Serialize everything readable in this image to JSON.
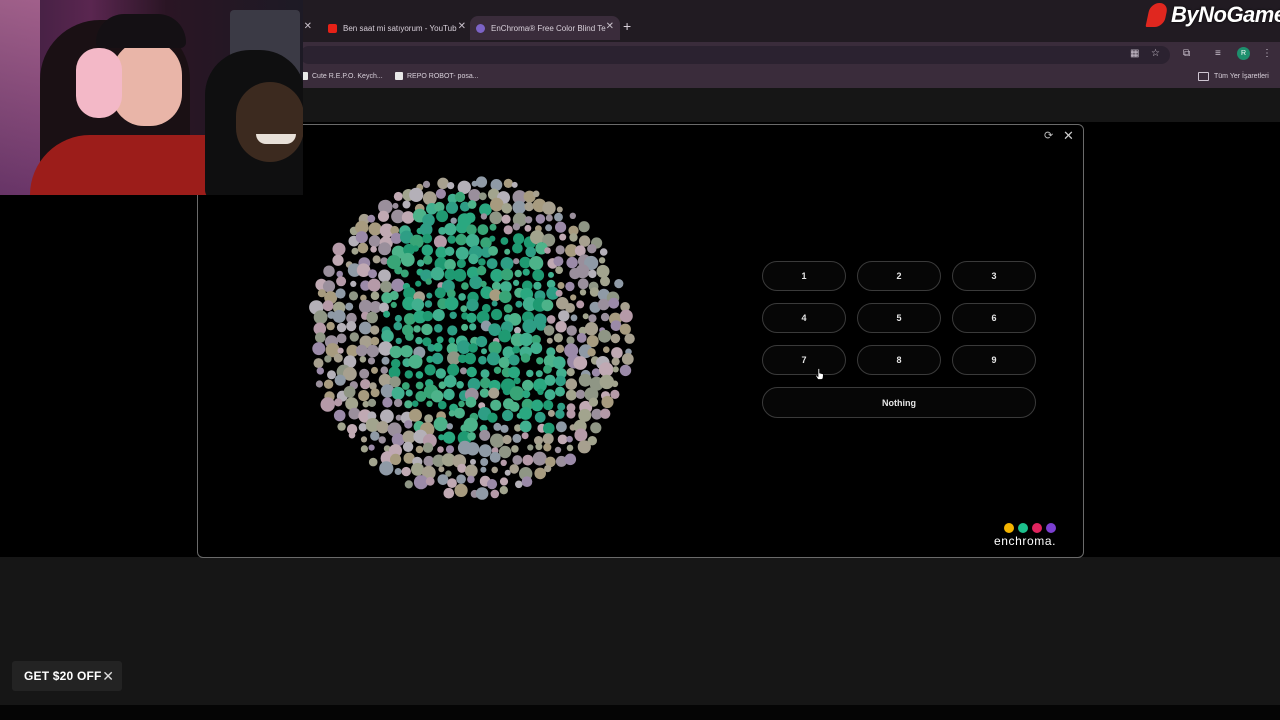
{
  "browser": {
    "tabs": [
      {
        "title": "Ben saat mi satıyorum - YouTub",
        "favicon_color": "#e62117"
      },
      {
        "title": "EnChroma® Free Color Blind Te",
        "favicon_color": "#7c63c6",
        "active": true
      }
    ],
    "new_tab_symbol": "+",
    "tab_close_symbol": "✕",
    "profile_initial": "R",
    "bookmarks": [
      {
        "label": "Cute R.E.P.O. Keych..."
      },
      {
        "label": "REPO ROBOT- posa..."
      }
    ],
    "bookmarks_folder": "Tüm Yer İşaretleri"
  },
  "brand_watermark": "ByNoGame",
  "modal": {
    "refresh_symbol": "⟳",
    "close_symbol": "✕",
    "answers": [
      "1",
      "2",
      "3",
      "4",
      "5",
      "6",
      "7",
      "8",
      "9"
    ],
    "nothing_label": "Nothing",
    "logo_text": "enchroma.",
    "logo_dot_colors": [
      "#f4b400",
      "#1dc08d",
      "#e0245e",
      "#7b3fd0"
    ]
  },
  "plate": {
    "background_dot_colors": [
      "#9a8f9c",
      "#a7a08f",
      "#8f9aa6",
      "#b59aa8",
      "#a2a48e",
      "#9b8aa8",
      "#c0a9b3",
      "#8f9685",
      "#a79b7f",
      "#b4b0b8"
    ],
    "figure_dot_colors": [
      "#1f9a72",
      "#2aa880",
      "#41b08f",
      "#38a577",
      "#4db38a",
      "#2e9e85"
    ]
  },
  "promo": {
    "label": "GET $20 OFF",
    "close_symbol": "✕"
  }
}
